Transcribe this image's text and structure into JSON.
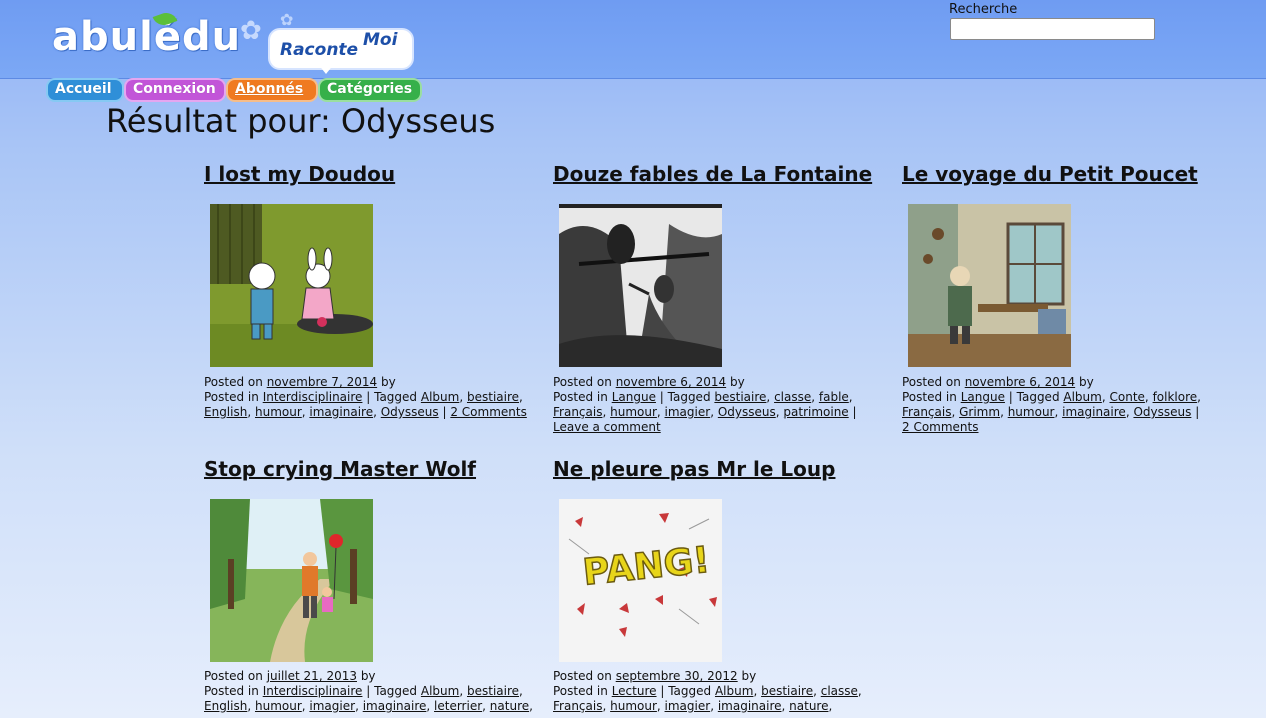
{
  "header": {
    "logo_text": "abulédu",
    "bubble_raconte": "Raconte",
    "bubble_moi": "Moi"
  },
  "search": {
    "label": "Recherche",
    "value": "",
    "placeholder": ""
  },
  "nav": {
    "tabs": [
      "Accueil",
      "Connexion",
      "Abonnés",
      "Catégories"
    ]
  },
  "page": {
    "title": "Résultat pour: Odysseus"
  },
  "posts": [
    {
      "title": "I lost my Doudou",
      "posted_on_label": "Posted on",
      "date": "novembre 7, 2014",
      "by": "by",
      "posted_in_label": "Posted in",
      "category": "Interdisciplinaire",
      "tagged_label": "Tagged",
      "tags": [
        "Album",
        "bestiaire",
        "English",
        "humour",
        "imaginaire",
        "Odysseus"
      ],
      "comments": "2 Comments"
    },
    {
      "title": "Douze fables de La Fontaine",
      "posted_on_label": "Posted on",
      "date": "novembre 6, 2014",
      "by": "by",
      "posted_in_label": "Posted in",
      "category": "Langue",
      "tagged_label": "Tagged",
      "tags": [
        "bestiaire",
        "classe",
        "fable",
        "Français",
        "humour",
        "imagier",
        "Odysseus",
        "patrimoine"
      ],
      "comments": "Leave a comment"
    },
    {
      "title": "Le voyage du Petit Poucet",
      "posted_on_label": "Posted on",
      "date": "novembre 6, 2014",
      "by": "by",
      "posted_in_label": "Posted in",
      "category": "Langue",
      "tagged_label": "Tagged",
      "tags": [
        "Album",
        "Conte",
        "folklore",
        "Français",
        "Grimm",
        "humour",
        "imaginaire",
        "Odysseus"
      ],
      "comments": "2 Comments"
    },
    {
      "title": "Stop crying Master Wolf",
      "posted_on_label": "Posted on",
      "date": "juillet 21, 2013",
      "by": "by",
      "posted_in_label": "Posted in",
      "category": "Interdisciplinaire",
      "tagged_label": "Tagged",
      "tags": [
        "Album",
        "bestiaire",
        "English",
        "humour",
        "imagier",
        "imaginaire",
        "leterrier",
        "nature"
      ]
    },
    {
      "title": "Ne pleure pas Mr le Loup",
      "posted_on_label": "Posted on",
      "date": "septembre 30, 2012",
      "by": "by",
      "posted_in_label": "Posted in",
      "category": "Lecture",
      "tagged_label": "Tagged",
      "tags": [
        "Album",
        "bestiaire",
        "classe",
        "Français",
        "humour",
        "imagier",
        "imaginaire",
        "nature"
      ],
      "pang_text": "PANG!"
    }
  ],
  "colors": {
    "header_bg": "#7ca8f5",
    "tab_accueil": "#2f8fd8",
    "tab_connexion": "#c255d8",
    "tab_abonnes": "#f07a20",
    "tab_categories": "#36b04a"
  }
}
